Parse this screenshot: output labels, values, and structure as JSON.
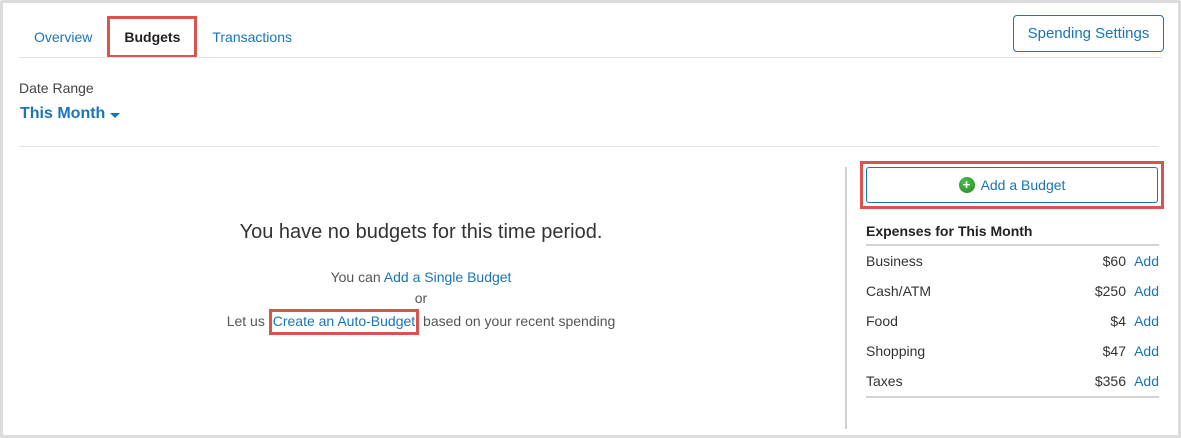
{
  "tabs": [
    {
      "label": "Overview",
      "active": false
    },
    {
      "label": "Budgets",
      "active": true
    },
    {
      "label": "Transactions",
      "active": false
    }
  ],
  "header": {
    "settings_label": "Spending Settings"
  },
  "date_range": {
    "label": "Date Range",
    "value": "This Month"
  },
  "empty_state": {
    "title": "You have no budgets for this time period.",
    "line1_prefix": "You can ",
    "line1_link": "Add a Single Budget",
    "or": "or",
    "line3_prefix": "Let us ",
    "line3_link": "Create an Auto-Budget",
    "line3_suffix": " based on your recent spending"
  },
  "sidebar": {
    "add_budget_label": "Add a Budget",
    "expenses_title": "Expenses for This Month",
    "expenses": [
      {
        "name": "Business",
        "amount": "$60",
        "action": "Add"
      },
      {
        "name": "Cash/ATM",
        "amount": "$250",
        "action": "Add"
      },
      {
        "name": "Food",
        "amount": "$4",
        "action": "Add"
      },
      {
        "name": "Shopping",
        "amount": "$47",
        "action": "Add"
      },
      {
        "name": "Taxes",
        "amount": "$356",
        "action": "Add"
      }
    ]
  },
  "colors": {
    "accent": "#1a74b8",
    "highlight": "#d9534f",
    "plus_icon": "#2e9e2e"
  },
  "icons": {
    "date_dropdown": "caret-down-icon",
    "add_budget": "plus-circle-icon"
  }
}
